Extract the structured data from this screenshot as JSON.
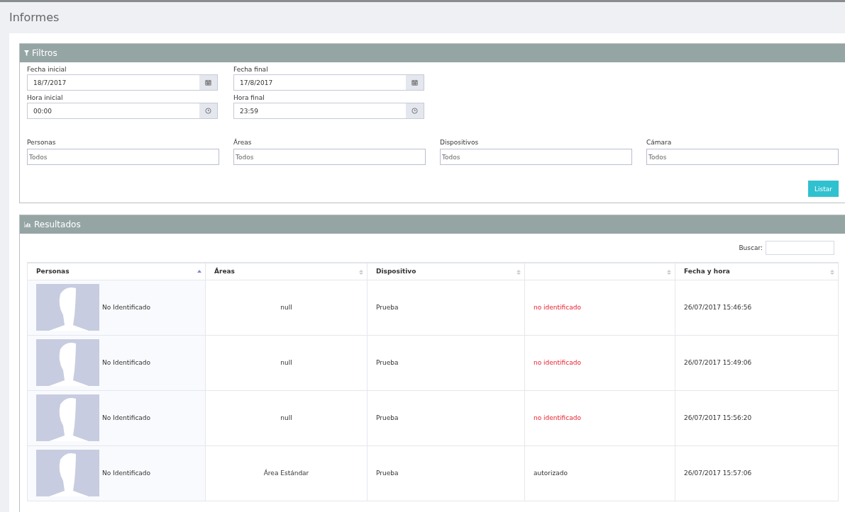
{
  "page_title": "Informes",
  "filters": {
    "title": "Filtros",
    "date_fields": [
      {
        "label": "Fecha inicial",
        "value": "18/7/2017",
        "kind": "date"
      },
      {
        "label": "Fecha final",
        "value": "17/8/2017",
        "kind": "date"
      },
      {
        "label": "Hora inicial",
        "value": "00:00",
        "kind": "time"
      },
      {
        "label": "Hora final",
        "value": "23:59",
        "kind": "time"
      }
    ],
    "selects": [
      {
        "label": "Personas",
        "placeholder": "Todos"
      },
      {
        "label": "Áreas",
        "placeholder": "Todos"
      },
      {
        "label": "Dispositivos",
        "placeholder": "Todos"
      },
      {
        "label": "Cámara",
        "placeholder": "Todos"
      }
    ],
    "submit": "Listar"
  },
  "results": {
    "title": "Resultados",
    "search_label": "Buscar:",
    "columns": [
      {
        "label": "Personas",
        "sorted": true
      },
      {
        "label": "Áreas",
        "sorted": false
      },
      {
        "label": "Dispositivo",
        "sorted": false
      },
      {
        "sorted": false
      },
      {
        "label": "Fecha y hora",
        "sorted": false
      }
    ],
    "rows": [
      {
        "person": "No Identificado",
        "area": "null",
        "device": "Prueba",
        "status": {
          "text": "no identificado",
          "kind": "denied"
        },
        "datetime": "26/07/2017 15:46:56"
      },
      {
        "person": "No Identificado",
        "area": "null",
        "device": "Prueba",
        "status": {
          "text": "no identificado",
          "kind": "denied"
        },
        "datetime": "26/07/2017 15:49:06"
      },
      {
        "person": "No Identificado",
        "area": "null",
        "device": "Prueba",
        "status": {
          "text": "no identificado",
          "kind": "denied"
        },
        "datetime": "26/07/2017 15:56:20"
      },
      {
        "person": "No Identificado",
        "area": "Área Estándar",
        "device": "Prueba",
        "status": {
          "text": "autorizado",
          "kind": "authorized"
        },
        "datetime": "26/07/2017 15:57:06"
      }
    ]
  }
}
